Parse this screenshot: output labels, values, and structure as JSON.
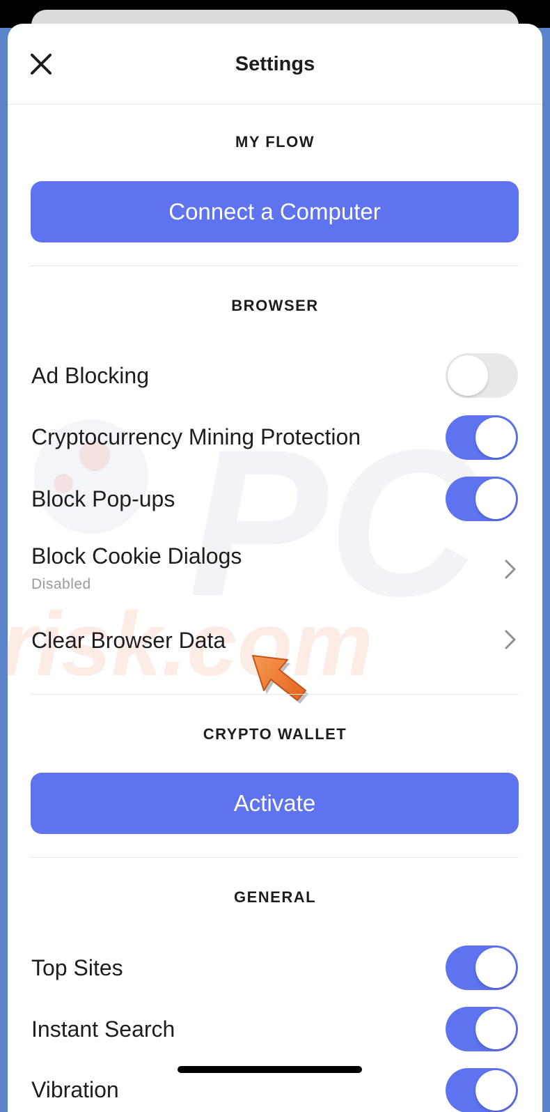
{
  "header": {
    "title": "Settings",
    "close_icon": "close-icon"
  },
  "sections": {
    "my_flow": {
      "title": "MY FLOW",
      "button_label": "Connect a Computer"
    },
    "browser": {
      "title": "BROWSER",
      "items": [
        {
          "label": "Ad Blocking",
          "type": "toggle",
          "on": false
        },
        {
          "label": "Cryptocurrency Mining Protection",
          "type": "toggle",
          "on": true
        },
        {
          "label": "Block Pop-ups",
          "type": "toggle",
          "on": true
        },
        {
          "label": "Block Cookie Dialogs",
          "sub": "Disabled",
          "type": "chevron"
        },
        {
          "label": "Clear Browser Data",
          "type": "chevron"
        }
      ]
    },
    "crypto_wallet": {
      "title": "CRYPTO WALLET",
      "button_label": "Activate"
    },
    "general": {
      "title": "GENERAL",
      "items": [
        {
          "label": "Top Sites",
          "type": "toggle",
          "on": true
        },
        {
          "label": "Instant Search",
          "type": "toggle",
          "on": true
        },
        {
          "label": "Vibration",
          "type": "toggle",
          "on": true
        }
      ]
    }
  },
  "watermark": {
    "text_top": "PC",
    "text_bottom": "risk.com"
  },
  "annotation": {
    "icon": "arrow-pointer-icon",
    "color": "#f07a2c"
  },
  "colors": {
    "accent": "#5d73ef",
    "backdrop": "#5b83c9"
  }
}
